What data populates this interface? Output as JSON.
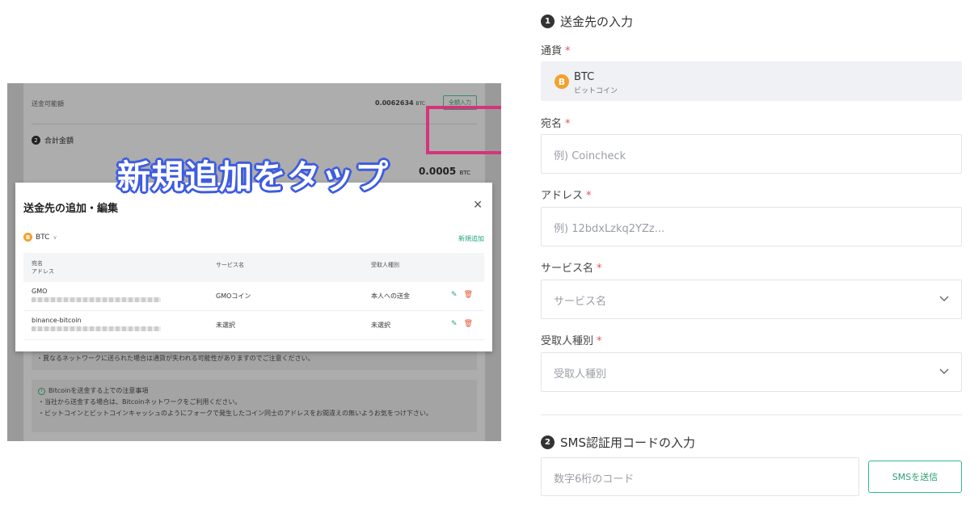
{
  "screenshot": {
    "overlay_caption": "新規追加をタップ",
    "background": {
      "available_label": "送金可能額",
      "available_value": "0.0062634",
      "available_unit": "BTC",
      "all_in_button": "全額入力",
      "total_badge": "2",
      "total_label": "合計金額",
      "total_amount": "0.0005",
      "total_unit": "BTC",
      "network_note": "・異なるネットワークに送られた場合は通貨が失われる可能性がありますのでご注意ください。",
      "caution_title": "Bitcoinを送金する上での注意事項",
      "caution_line1": "・当社から送金する場合は、Bitcoinネットワークをご利用ください。",
      "caution_line2": "・ビットコインとビットコインキャッシュのようにフォークで発生したコイン同士のアドレスをお間違えの無いようお気をつけ下さい。"
    },
    "modal": {
      "title": "送金先の追加・編集",
      "close_glyph": "✕",
      "currency": "BTC",
      "new_link": "新規追加",
      "table_headers": {
        "name": "宛名",
        "address": "アドレス",
        "service": "サービス名",
        "recipient_type": "受取人種別"
      },
      "rows": [
        {
          "name": "GMO",
          "service": "GMOコイン",
          "recipient_type": "本人への送金"
        },
        {
          "name": "binance-bitcoin",
          "service": "未選択",
          "recipient_type": "未選択"
        }
      ]
    }
  },
  "form": {
    "section1": {
      "badge": "1",
      "title": "送金先の入力"
    },
    "currency": {
      "label": "通貨",
      "required": "*",
      "symbol": "BTC",
      "name": "ビットコイン",
      "coin_glyph": "B"
    },
    "name": {
      "label": "宛名",
      "required": "*",
      "placeholder": "例) Coincheck"
    },
    "address": {
      "label": "アドレス",
      "required": "*",
      "placeholder": "例) 12bdxLzkq2YZz..."
    },
    "service": {
      "label": "サービス名",
      "required": "*",
      "placeholder": "サービス名"
    },
    "recipient": {
      "label": "受取人種別",
      "required": "*",
      "placeholder": "受取人種別"
    },
    "section2": {
      "badge": "2",
      "title": "SMS認証用コードの入力"
    },
    "code": {
      "placeholder": "数字6桁のコード"
    },
    "sms_button": "SMSを送信"
  },
  "colors": {
    "accent_green": "#2ebd85",
    "highlight_pink": "#d6347a",
    "caption_outline": "#3e5ce0",
    "bitcoin_orange": "#f2a12c",
    "required_red": "#e0535a"
  },
  "icons": [
    "bitcoin-icon",
    "close-icon",
    "chevron-down-icon",
    "edit-icon",
    "trash-icon",
    "info-icon"
  ]
}
